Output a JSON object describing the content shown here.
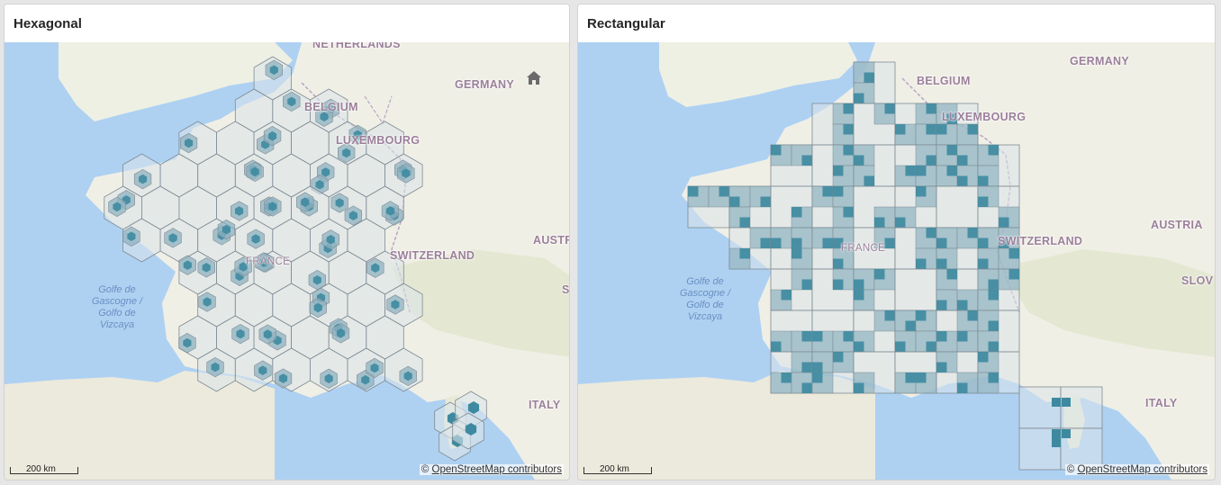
{
  "panels": {
    "hex": {
      "title": "Hexagonal",
      "labels": {
        "netherlands": "NETHERLANDS",
        "belgium": "BELGIUM",
        "germany": "GERMANY",
        "luxembourg": "LUXEMBOURG",
        "france": "FRANCE",
        "switzerland": "SWITZERLAND",
        "austria": "AUSTRI",
        "slovenia": "S",
        "italy": "ITALY"
      },
      "sea": "Golfe de\nGascogne /\nGolfo de\nVizcaya",
      "scale": "200 km",
      "attribution_prefix": "©",
      "attribution_link": "OpenStreetMap contributors"
    },
    "rect": {
      "title": "Rectangular",
      "labels": {
        "belgium": "BELGIUM",
        "germany": "GERMANY",
        "luxembourg": "LUXEMBOURG",
        "france": "FRANCE",
        "switzerland": "SWITZERLAND",
        "austria": "AUSTRIA",
        "slovenia": "SLOV",
        "italy": "ITALY"
      },
      "sea": "Golfe de\nGascogne /\nGolfo de\nVizcaya",
      "scale": "200 km",
      "attribution_prefix": "©",
      "attribution_link": "OpenStreetMap contributors"
    }
  },
  "icons": {
    "home": "home-icon"
  },
  "colors": {
    "water": "#aed1f2",
    "land": "#f0efe6",
    "bin_stroke": "#7f8b93",
    "bin_fill_light": "#dbe4ea",
    "bin_fill_mid": "#8fb2c0",
    "bin_fill_dark": "#3d8aa0"
  }
}
